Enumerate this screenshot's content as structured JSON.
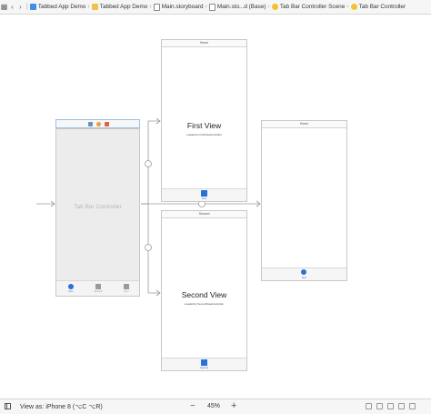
{
  "jumpbar": {
    "items": [
      {
        "label": "Tabbed App Demo",
        "icon": "project-icon"
      },
      {
        "label": "Tabbed App Demo",
        "icon": "folder-icon"
      },
      {
        "label": "Main.storyboard",
        "icon": "storyboard-file-icon"
      },
      {
        "label": "Main.sto...d (Base)",
        "icon": "storyboard-file-icon"
      },
      {
        "label": "Tab Bar Controller Scene",
        "icon": "scene-icon"
      },
      {
        "label": "Tab Bar Controller",
        "icon": "tab-bar-controller-icon"
      }
    ]
  },
  "scenes": {
    "tab_bar_controller": {
      "label": "Tab Bar Controller",
      "tabs": [
        "Item",
        "Second",
        "Item"
      ]
    },
    "first": {
      "title_bar": "Home",
      "heading": "First View",
      "subheading": "Loaded by FirstViewController",
      "tab_label": "First"
    },
    "second": {
      "title_bar": "Second",
      "heading": "Second View",
      "subheading": "Loaded by SecondViewController",
      "tab_label": "Second"
    },
    "third": {
      "title_bar": "Home",
      "tab_label": "Item"
    }
  },
  "bottombar": {
    "view_as": "View as: iPhone 8 (⌥C ⌥R)",
    "zoom_out": "−",
    "zoom": "45%",
    "zoom_in": "+"
  },
  "colors": {
    "accent": "#2b6fd8",
    "canvas": "#ffffff",
    "segue": "#9a9a9a"
  }
}
